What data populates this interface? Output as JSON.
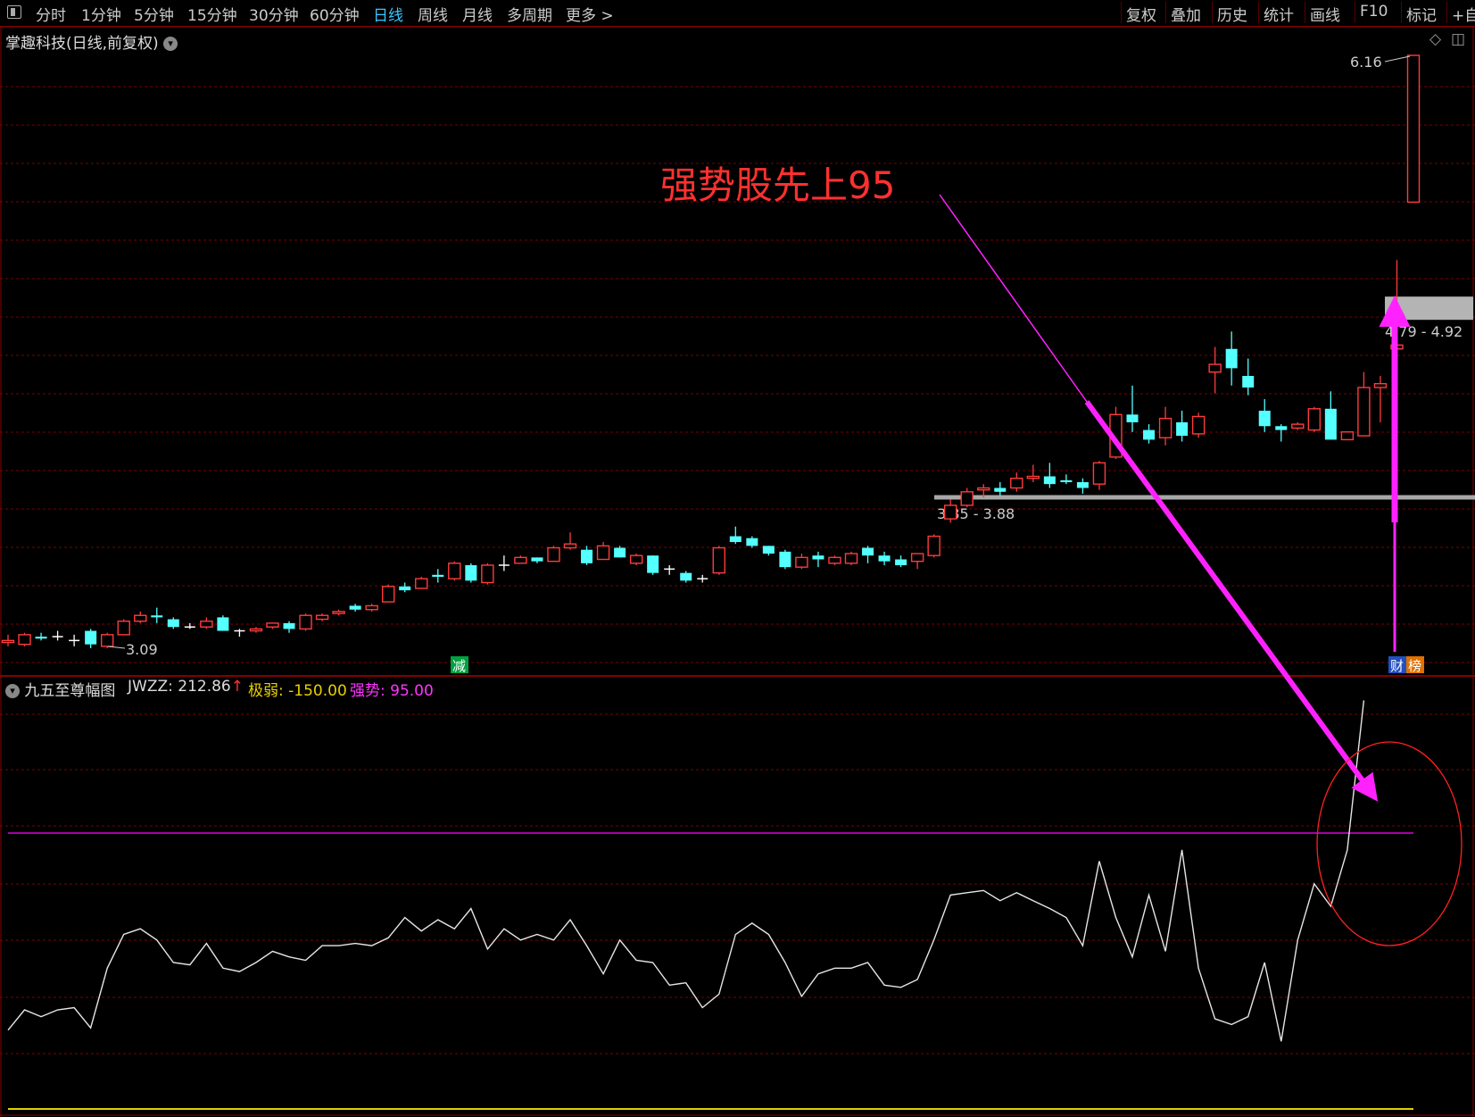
{
  "toolbar": {
    "periods": [
      "分时",
      "1分钟",
      "5分钟",
      "15分钟",
      "30分钟",
      "60分钟",
      "日线",
      "周线",
      "月线",
      "多周期",
      "更多 >"
    ],
    "active": "日线",
    "right_items": [
      "复权",
      "叠加",
      "历史",
      "统计",
      "画线",
      "F10",
      "标记",
      "+自"
    ]
  },
  "main_chart": {
    "title": "掌趣科技(日线,前复权)",
    "annotation": "强势股先上95",
    "high_label": "6.16",
    "low_label": "3.09",
    "zone_upper_label": "4.79 - 4.92",
    "zone_lower_label": "3.85 - 3.88",
    "badge_reduce": "减",
    "badge_cai": "财",
    "badge_bang": "榜"
  },
  "indicator": {
    "name": "九五至尊幅图",
    "jwzz_label": "JWZZ:",
    "jwzz_value": "212.86",
    "jwzz_arrow": "↑",
    "weak_label": "极弱:",
    "weak_value": "-150.00",
    "strong_label": "强势:",
    "strong_value": "95.00"
  },
  "chart_data": {
    "type": "candlestick",
    "price_range": [
      3.0,
      6.3
    ],
    "candles": [
      {
        "o": 3.12,
        "c": 3.13,
        "h": 3.16,
        "l": 3.1
      },
      {
        "o": 3.11,
        "c": 3.16,
        "h": 3.17,
        "l": 3.1
      },
      {
        "o": 3.15,
        "c": 3.14,
        "h": 3.17,
        "l": 3.13
      },
      {
        "o": 3.15,
        "c": 3.15,
        "h": 3.18,
        "l": 3.13
      },
      {
        "o": 3.13,
        "c": 3.13,
        "h": 3.16,
        "l": 3.1
      },
      {
        "o": 3.18,
        "c": 3.11,
        "h": 3.19,
        "l": 3.09
      },
      {
        "o": 3.1,
        "c": 3.16,
        "h": 3.17,
        "l": 3.09
      },
      {
        "o": 3.16,
        "c": 3.23,
        "h": 3.24,
        "l": 3.16
      },
      {
        "o": 3.23,
        "c": 3.26,
        "h": 3.28,
        "l": 3.22
      },
      {
        "o": 3.26,
        "c": 3.25,
        "h": 3.3,
        "l": 3.22
      },
      {
        "o": 3.24,
        "c": 3.2,
        "h": 3.25,
        "l": 3.19
      },
      {
        "o": 3.2,
        "c": 3.2,
        "h": 3.22,
        "l": 3.19
      },
      {
        "o": 3.2,
        "c": 3.23,
        "h": 3.25,
        "l": 3.19
      },
      {
        "o": 3.25,
        "c": 3.18,
        "h": 3.26,
        "l": 3.18
      },
      {
        "o": 3.18,
        "c": 3.18,
        "h": 3.19,
        "l": 3.15
      },
      {
        "o": 3.18,
        "c": 3.19,
        "h": 3.2,
        "l": 3.17
      },
      {
        "o": 3.2,
        "c": 3.22,
        "h": 3.22,
        "l": 3.19
      },
      {
        "o": 3.22,
        "c": 3.19,
        "h": 3.23,
        "l": 3.17
      },
      {
        "o": 3.19,
        "c": 3.26,
        "h": 3.27,
        "l": 3.18
      },
      {
        "o": 3.24,
        "c": 3.26,
        "h": 3.27,
        "l": 3.23
      },
      {
        "o": 3.27,
        "c": 3.28,
        "h": 3.29,
        "l": 3.26
      },
      {
        "o": 3.31,
        "c": 3.29,
        "h": 3.32,
        "l": 3.28
      },
      {
        "o": 3.29,
        "c": 3.31,
        "h": 3.32,
        "l": 3.28
      },
      {
        "o": 3.33,
        "c": 3.41,
        "h": 3.42,
        "l": 3.33
      },
      {
        "o": 3.41,
        "c": 3.39,
        "h": 3.43,
        "l": 3.38
      },
      {
        "o": 3.4,
        "c": 3.45,
        "h": 3.46,
        "l": 3.4
      },
      {
        "o": 3.47,
        "c": 3.46,
        "h": 3.5,
        "l": 3.43
      },
      {
        "o": 3.45,
        "c": 3.53,
        "h": 3.54,
        "l": 3.44
      },
      {
        "o": 3.52,
        "c": 3.44,
        "h": 3.53,
        "l": 3.43
      },
      {
        "o": 3.43,
        "c": 3.52,
        "h": 3.53,
        "l": 3.42
      },
      {
        "o": 3.52,
        "c": 3.52,
        "h": 3.57,
        "l": 3.49
      },
      {
        "o": 3.53,
        "c": 3.56,
        "h": 3.57,
        "l": 3.53
      },
      {
        "o": 3.56,
        "c": 3.54,
        "h": 3.56,
        "l": 3.53
      },
      {
        "o": 3.54,
        "c": 3.61,
        "h": 3.62,
        "l": 3.54
      },
      {
        "o": 3.61,
        "c": 3.63,
        "h": 3.69,
        "l": 3.6
      },
      {
        "o": 3.6,
        "c": 3.53,
        "h": 3.62,
        "l": 3.52
      },
      {
        "o": 3.55,
        "c": 3.62,
        "h": 3.64,
        "l": 3.55
      },
      {
        "o": 3.61,
        "c": 3.56,
        "h": 3.62,
        "l": 3.56
      },
      {
        "o": 3.53,
        "c": 3.57,
        "h": 3.58,
        "l": 3.52
      },
      {
        "o": 3.57,
        "c": 3.48,
        "h": 3.57,
        "l": 3.47
      },
      {
        "o": 3.5,
        "c": 3.5,
        "h": 3.52,
        "l": 3.47
      },
      {
        "o": 3.48,
        "c": 3.44,
        "h": 3.49,
        "l": 3.43
      },
      {
        "o": 3.45,
        "c": 3.45,
        "h": 3.47,
        "l": 3.43
      },
      {
        "o": 3.48,
        "c": 3.61,
        "h": 3.62,
        "l": 3.47
      },
      {
        "o": 3.67,
        "c": 3.64,
        "h": 3.72,
        "l": 3.63
      },
      {
        "o": 3.66,
        "c": 3.62,
        "h": 3.67,
        "l": 3.61
      },
      {
        "o": 3.62,
        "c": 3.58,
        "h": 3.62,
        "l": 3.57
      },
      {
        "o": 3.59,
        "c": 3.51,
        "h": 3.6,
        "l": 3.5
      },
      {
        "o": 3.51,
        "c": 3.56,
        "h": 3.58,
        "l": 3.5
      },
      {
        "o": 3.57,
        "c": 3.55,
        "h": 3.59,
        "l": 3.51
      },
      {
        "o": 3.53,
        "c": 3.56,
        "h": 3.57,
        "l": 3.52
      },
      {
        "o": 3.53,
        "c": 3.58,
        "h": 3.59,
        "l": 3.52
      },
      {
        "o": 3.61,
        "c": 3.57,
        "h": 3.62,
        "l": 3.53
      },
      {
        "o": 3.57,
        "c": 3.54,
        "h": 3.59,
        "l": 3.52
      },
      {
        "o": 3.55,
        "c": 3.52,
        "h": 3.57,
        "l": 3.51
      },
      {
        "o": 3.54,
        "c": 3.58,
        "h": 3.58,
        "l": 3.5
      },
      {
        "o": 3.57,
        "c": 3.67,
        "h": 3.68,
        "l": 3.56
      },
      {
        "o": 3.76,
        "c": 3.83,
        "h": 3.86,
        "l": 3.74
      },
      {
        "o": 3.83,
        "c": 3.9,
        "h": 3.92,
        "l": 3.82
      },
      {
        "o": 3.91,
        "c": 3.92,
        "h": 3.94,
        "l": 3.87
      },
      {
        "o": 3.92,
        "c": 3.9,
        "h": 3.95,
        "l": 3.88
      },
      {
        "o": 3.92,
        "c": 3.97,
        "h": 4.0,
        "l": 3.9
      },
      {
        "o": 3.97,
        "c": 3.98,
        "h": 4.04,
        "l": 3.95
      },
      {
        "o": 3.98,
        "c": 3.94,
        "h": 4.05,
        "l": 3.92
      },
      {
        "o": 3.96,
        "c": 3.95,
        "h": 3.99,
        "l": 3.94
      },
      {
        "o": 3.95,
        "c": 3.92,
        "h": 3.97,
        "l": 3.89
      },
      {
        "o": 3.94,
        "c": 4.05,
        "h": 4.06,
        "l": 3.91
      },
      {
        "o": 4.08,
        "c": 4.3,
        "h": 4.34,
        "l": 4.07
      },
      {
        "o": 4.3,
        "c": 4.26,
        "h": 4.45,
        "l": 4.21
      },
      {
        "o": 4.22,
        "c": 4.17,
        "h": 4.25,
        "l": 4.15
      },
      {
        "o": 4.18,
        "c": 4.28,
        "h": 4.34,
        "l": 4.14
      },
      {
        "o": 4.26,
        "c": 4.19,
        "h": 4.32,
        "l": 4.16
      },
      {
        "o": 4.2,
        "c": 4.29,
        "h": 4.31,
        "l": 4.18
      },
      {
        "o": 4.52,
        "c": 4.56,
        "h": 4.65,
        "l": 4.41
      },
      {
        "o": 4.64,
        "c": 4.54,
        "h": 4.73,
        "l": 4.45
      },
      {
        "o": 4.5,
        "c": 4.44,
        "h": 4.59,
        "l": 4.4
      },
      {
        "o": 4.32,
        "c": 4.24,
        "h": 4.38,
        "l": 4.21
      },
      {
        "o": 4.24,
        "c": 4.22,
        "h": 4.25,
        "l": 4.16
      },
      {
        "o": 4.23,
        "c": 4.25,
        "h": 4.26,
        "l": 4.22
      },
      {
        "o": 4.22,
        "c": 4.33,
        "h": 4.34,
        "l": 4.21
      },
      {
        "o": 4.33,
        "c": 4.17,
        "h": 4.42,
        "l": 4.17
      },
      {
        "o": 4.17,
        "c": 4.21,
        "h": 4.21,
        "l": 4.17
      },
      {
        "o": 4.19,
        "c": 4.44,
        "h": 4.52,
        "l": 4.19
      },
      {
        "o": 4.44,
        "c": 4.46,
        "h": 4.5,
        "l": 4.26
      },
      {
        "o": 4.64,
        "c": 4.66,
        "h": 5.1,
        "l": 4.53
      },
      {
        "o": 5.4,
        "c": 6.16,
        "h": 6.16,
        "l": 5.4
      }
    ],
    "zones": [
      {
        "label": "4.79 - 4.92",
        "low": 4.79,
        "high": 4.92
      },
      {
        "label": "3.85 - 3.88",
        "low": 3.85,
        "high": 3.88
      }
    ],
    "indicator_series": {
      "name": "JWZZ",
      "ylim": [
        -200,
        250
      ],
      "reference_lines": {
        "strong": 95,
        "weak": -150
      },
      "values": [
        -80,
        -62,
        -68,
        -62,
        -60,
        -78,
        -25,
        5,
        10,
        0,
        -20,
        -22,
        -3,
        -25,
        -28,
        -20,
        -10,
        -15,
        -18,
        -5,
        -5,
        -3,
        -5,
        2,
        20,
        8,
        18,
        10,
        28,
        -8,
        10,
        0,
        5,
        0,
        18,
        -5,
        -30,
        0,
        -18,
        -20,
        -40,
        -38,
        -60,
        -48,
        5,
        15,
        5,
        -20,
        -50,
        -30,
        -25,
        -25,
        -20,
        -40,
        -42,
        -35,
        0,
        40,
        42,
        44,
        35,
        42,
        35,
        28,
        20,
        -5,
        70,
        20,
        -15,
        40,
        -10,
        80,
        -25,
        -70,
        -75,
        -68,
        -20,
        -90,
        0,
        50,
        30,
        80,
        212.86
      ]
    }
  }
}
